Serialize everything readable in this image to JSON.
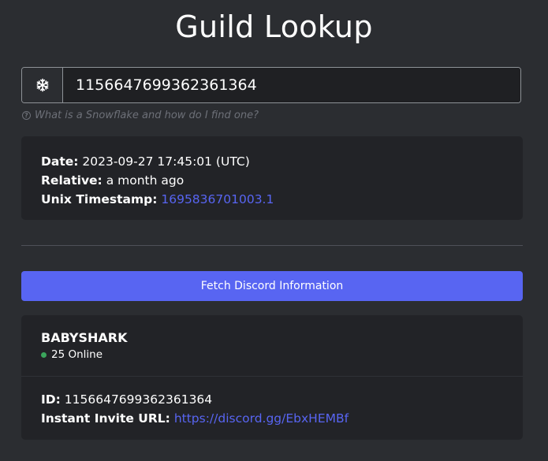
{
  "page": {
    "title": "Guild Lookup"
  },
  "search": {
    "icon": "snowflake-icon",
    "value": "1156647699362361364",
    "help_text": "What is a Snowflake and how do I find one?"
  },
  "timestamp_card": {
    "date_label": "Date:",
    "date_value": "2023-09-27 17:45:01 (UTC)",
    "relative_label": "Relative:",
    "relative_value": "a month ago",
    "unix_label": "Unix Timestamp:",
    "unix_value": "1695836701003.1"
  },
  "fetch_button": {
    "label": "Fetch Discord Information"
  },
  "guild_card": {
    "name": "BABYSHARK",
    "online_text": "25 Online",
    "id_label": "ID:",
    "id_value": "1156647699362361364",
    "invite_label": "Instant Invite URL:",
    "invite_value": "https://discord.gg/EbxHEMBf"
  },
  "colors": {
    "background": "#2b2d31",
    "card": "#222327",
    "accent": "#5865f2",
    "online": "#3ba55c"
  }
}
